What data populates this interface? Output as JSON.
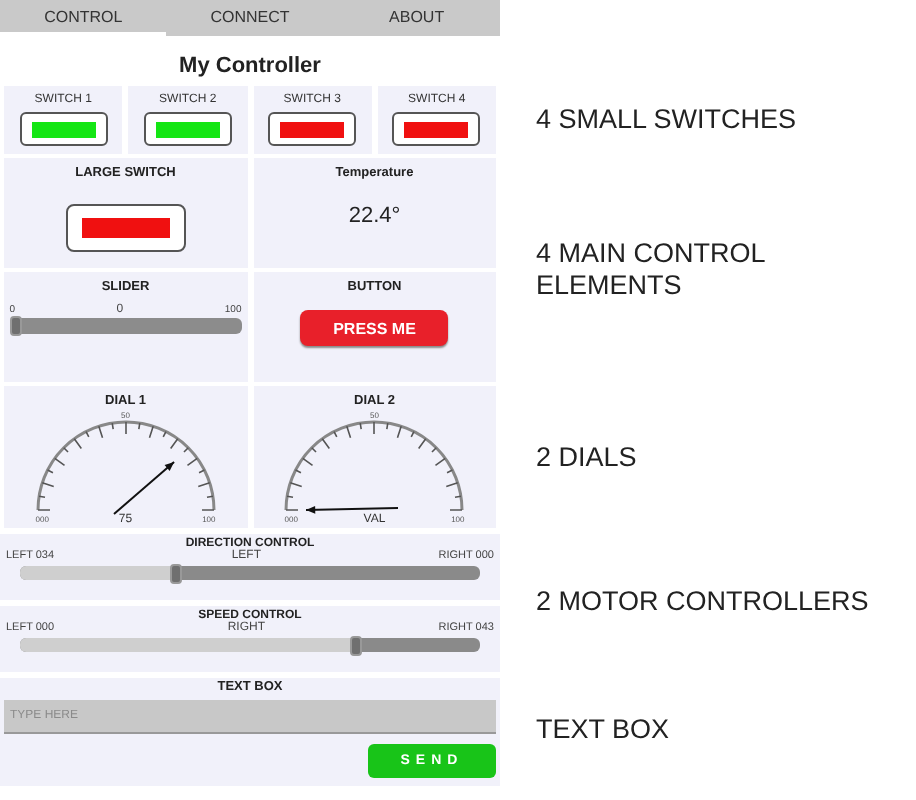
{
  "tabs": [
    {
      "label": "CONTROL",
      "selected": true
    },
    {
      "label": "CONNECT",
      "selected": false
    },
    {
      "label": "ABOUT",
      "selected": false
    }
  ],
  "title": "My Controller",
  "switches": [
    {
      "label": "SWITCH 1",
      "on": true
    },
    {
      "label": "SWITCH 2",
      "on": true
    },
    {
      "label": "SWITCH 3",
      "on": false
    },
    {
      "label": "SWITCH 4",
      "on": false
    }
  ],
  "large_switch": {
    "label": "LARGE SWITCH",
    "on": false
  },
  "temperature": {
    "label": "Temperature",
    "value": "22.4°"
  },
  "slider": {
    "label": "SLIDER",
    "min": "0",
    "value": "0",
    "max": "100",
    "level": 0
  },
  "button": {
    "label": "BUTTON",
    "text": "PRESS ME"
  },
  "dials": [
    {
      "label": "DIAL 1",
      "min": "000",
      "mid": "50",
      "max": "100",
      "value": "75"
    },
    {
      "label": "DIAL 2",
      "min": "000",
      "mid": "50",
      "max": "100",
      "value": "VAL"
    }
  ],
  "motor_controls": [
    {
      "label": "DIRECTION CONTROL",
      "left": "LEFT 034",
      "center": "LEFT",
      "right": "RIGHT 000",
      "level": 0.34
    },
    {
      "label": "SPEED CONTROL",
      "left": "LEFT 000",
      "center": "RIGHT",
      "right": "RIGHT 043",
      "level": 0.73
    }
  ],
  "text_box": {
    "label": "TEXT BOX",
    "placeholder": "TYPE HERE",
    "send": "SEND"
  },
  "annotations": [
    "4 SMALL SWITCHES",
    "4 MAIN CONTROL ELEMENTS",
    "2 DIALS",
    "2 MOTOR CONTROLLERS",
    "TEXT BOX"
  ]
}
